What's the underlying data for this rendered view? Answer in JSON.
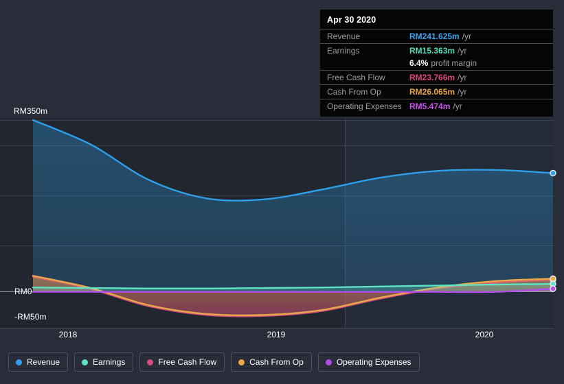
{
  "chart_data": {
    "type": "line",
    "title": "",
    "xlabel": "",
    "ylabel": "",
    "currency_prefix": "RM",
    "ylim": [
      -50,
      350
    ],
    "y_ticks": [
      {
        "value": 350,
        "label": "RM350m"
      },
      {
        "value": 0,
        "label": "RM0"
      },
      {
        "value": -50,
        "label": "-RM50m"
      }
    ],
    "x_ticks": [
      {
        "label": "2018"
      },
      {
        "label": "2019"
      },
      {
        "label": "2020"
      }
    ],
    "grid": true,
    "legend_position": "bottom",
    "forecast_divider_label": "",
    "series": [
      {
        "name": "Revenue",
        "color": "#2e9fe8",
        "values": [
          350,
          300,
          228,
          190,
          188,
          208,
          232,
          246,
          248,
          241.625
        ]
      },
      {
        "name": "Earnings",
        "color": "#5ee3c4",
        "values": [
          8,
          7,
          6,
          6,
          7,
          8,
          10,
          12,
          14,
          15.363
        ]
      },
      {
        "name": "Free Cash Flow",
        "color": "#d94b7c",
        "values": [
          30,
          5,
          -30,
          -48,
          -50,
          -40,
          -15,
          6,
          18,
          23.766
        ]
      },
      {
        "name": "Cash From Op",
        "color": "#e8a84a",
        "values": [
          32,
          7,
          -28,
          -46,
          -48,
          -38,
          -13,
          8,
          21,
          26.065
        ]
      },
      {
        "name": "Operating Expenses",
        "color": "#b44ae8",
        "values": [
          -1,
          -1,
          -1,
          -1,
          -1,
          -1,
          -1,
          -1,
          -1,
          5.474
        ]
      }
    ]
  },
  "tooltip": {
    "title": "Apr 30 2020",
    "rows": [
      {
        "label": "Revenue",
        "value": "RM241.625m",
        "unit": "/yr",
        "color": "#3aa3f0"
      },
      {
        "label": "Earnings",
        "value": "RM15.363m",
        "unit": "/yr",
        "color": "#4fdcbb"
      },
      {
        "label": "",
        "value": "6.4%",
        "unit": "profit margin",
        "color": "#ffffff",
        "sub": true
      },
      {
        "label": "Free Cash Flow",
        "value": "RM23.766m",
        "unit": "/yr",
        "color": "#e0437e"
      },
      {
        "label": "Cash From Op",
        "value": "RM26.065m",
        "unit": "/yr",
        "color": "#e8a441"
      },
      {
        "label": "Operating Expenses",
        "value": "RM5.474m",
        "unit": "/yr",
        "color": "#cb4ff0"
      }
    ]
  },
  "legend": {
    "items": [
      {
        "label": "Revenue",
        "color": "#2e9fe8"
      },
      {
        "label": "Earnings",
        "color": "#5ee3c4"
      },
      {
        "label": "Free Cash Flow",
        "color": "#d94b7c"
      },
      {
        "label": "Cash From Op",
        "color": "#e8a84a"
      },
      {
        "label": "Operating Expenses",
        "color": "#b44ae8"
      }
    ]
  },
  "axis": {
    "y_top_label": "RM350m",
    "y_zero_label": "RM0",
    "y_bottom_label": "-RM50m",
    "x_2018": "2018",
    "x_2019": "2019",
    "x_2020": "2020"
  }
}
